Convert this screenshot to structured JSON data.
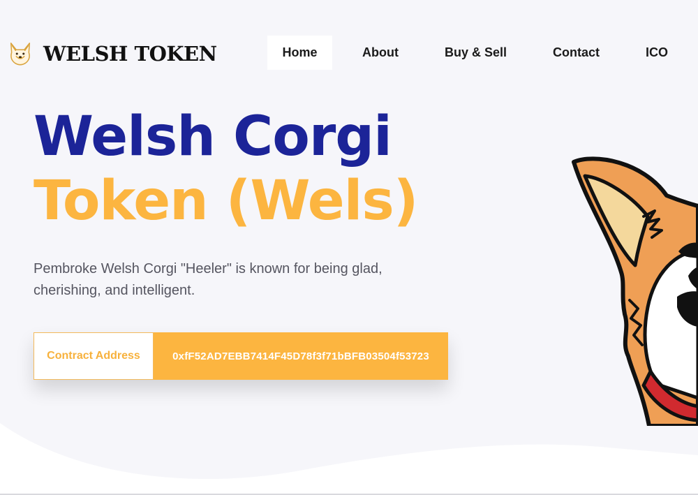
{
  "header": {
    "brand_name": "WELSH TOKEN",
    "logo_icon": "corgi-head-logo"
  },
  "nav": {
    "items": [
      {
        "label": "Home",
        "active": true
      },
      {
        "label": "About"
      },
      {
        "label": "Buy & Sell"
      },
      {
        "label": "Contact"
      },
      {
        "label": "ICO"
      }
    ]
  },
  "hero": {
    "title_line1": "Welsh Corgi",
    "title_line2": "Token (Wels)",
    "description": "Pembroke Welsh Corgi \"Heeler\" is known for being glad, cherishing, and intelligent.",
    "contract_label": "Contract Address",
    "contract_address": "0xfF52AD7EBB7414F45D78f3f71bBFB03504f53723",
    "illustration": "corgi-illustration"
  },
  "colors": {
    "primary_blue": "#1c2498",
    "accent_orange": "#fcb540",
    "background": "#f6f6fa"
  }
}
